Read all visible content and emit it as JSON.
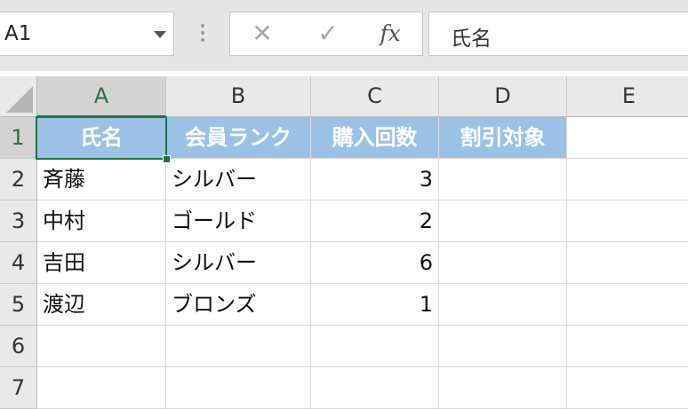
{
  "formula_bar": {
    "name_box": "A1",
    "cancel_icon": "✕",
    "enter_icon": "✓",
    "function_label": "fx",
    "content": "氏名"
  },
  "columns": [
    "A",
    "B",
    "C",
    "D",
    "E"
  ],
  "rows": [
    "1",
    "2",
    "3",
    "4",
    "5",
    "6",
    "7"
  ],
  "selected_cell": "A1",
  "header_fill_color": "#9bc2e6",
  "selection_color": "#217346",
  "table": {
    "headers": [
      "氏名",
      "会員ランク",
      "購入回数",
      "割引対象"
    ],
    "rows": [
      [
        "斉藤",
        "シルバー",
        "3",
        ""
      ],
      [
        "中村",
        "ゴールド",
        "2",
        ""
      ],
      [
        "吉田",
        "シルバー",
        "6",
        ""
      ],
      [
        "渡辺",
        "ブロンズ",
        "1",
        ""
      ]
    ]
  }
}
